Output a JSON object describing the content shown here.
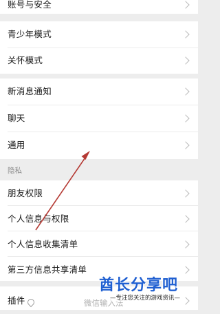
{
  "rows": {
    "account_security": "账号与安全",
    "teen_mode": "青少年模式",
    "care_mode": "关怀模式",
    "new_message_notification": "新消息通知",
    "chat": "聊天",
    "general": "通用",
    "friend_permissions": "朋友权限",
    "personal_info_permissions": "个人信息与权限",
    "personal_info_collection_list": "个人信息收集清单",
    "third_party_sharing_list": "第三方信息共享清单",
    "plugins": "插件"
  },
  "sections": {
    "privacy": "隐私"
  },
  "plugins_tail": "微信输入法",
  "watermark": {
    "title": "酋长分享吧",
    "subtitle": "—专注您关注的游戏资讯—"
  },
  "colors": {
    "background": "#ededed",
    "card": "#ffffff",
    "arrow": "#b53a34",
    "watermark": "#1f5fd1"
  }
}
